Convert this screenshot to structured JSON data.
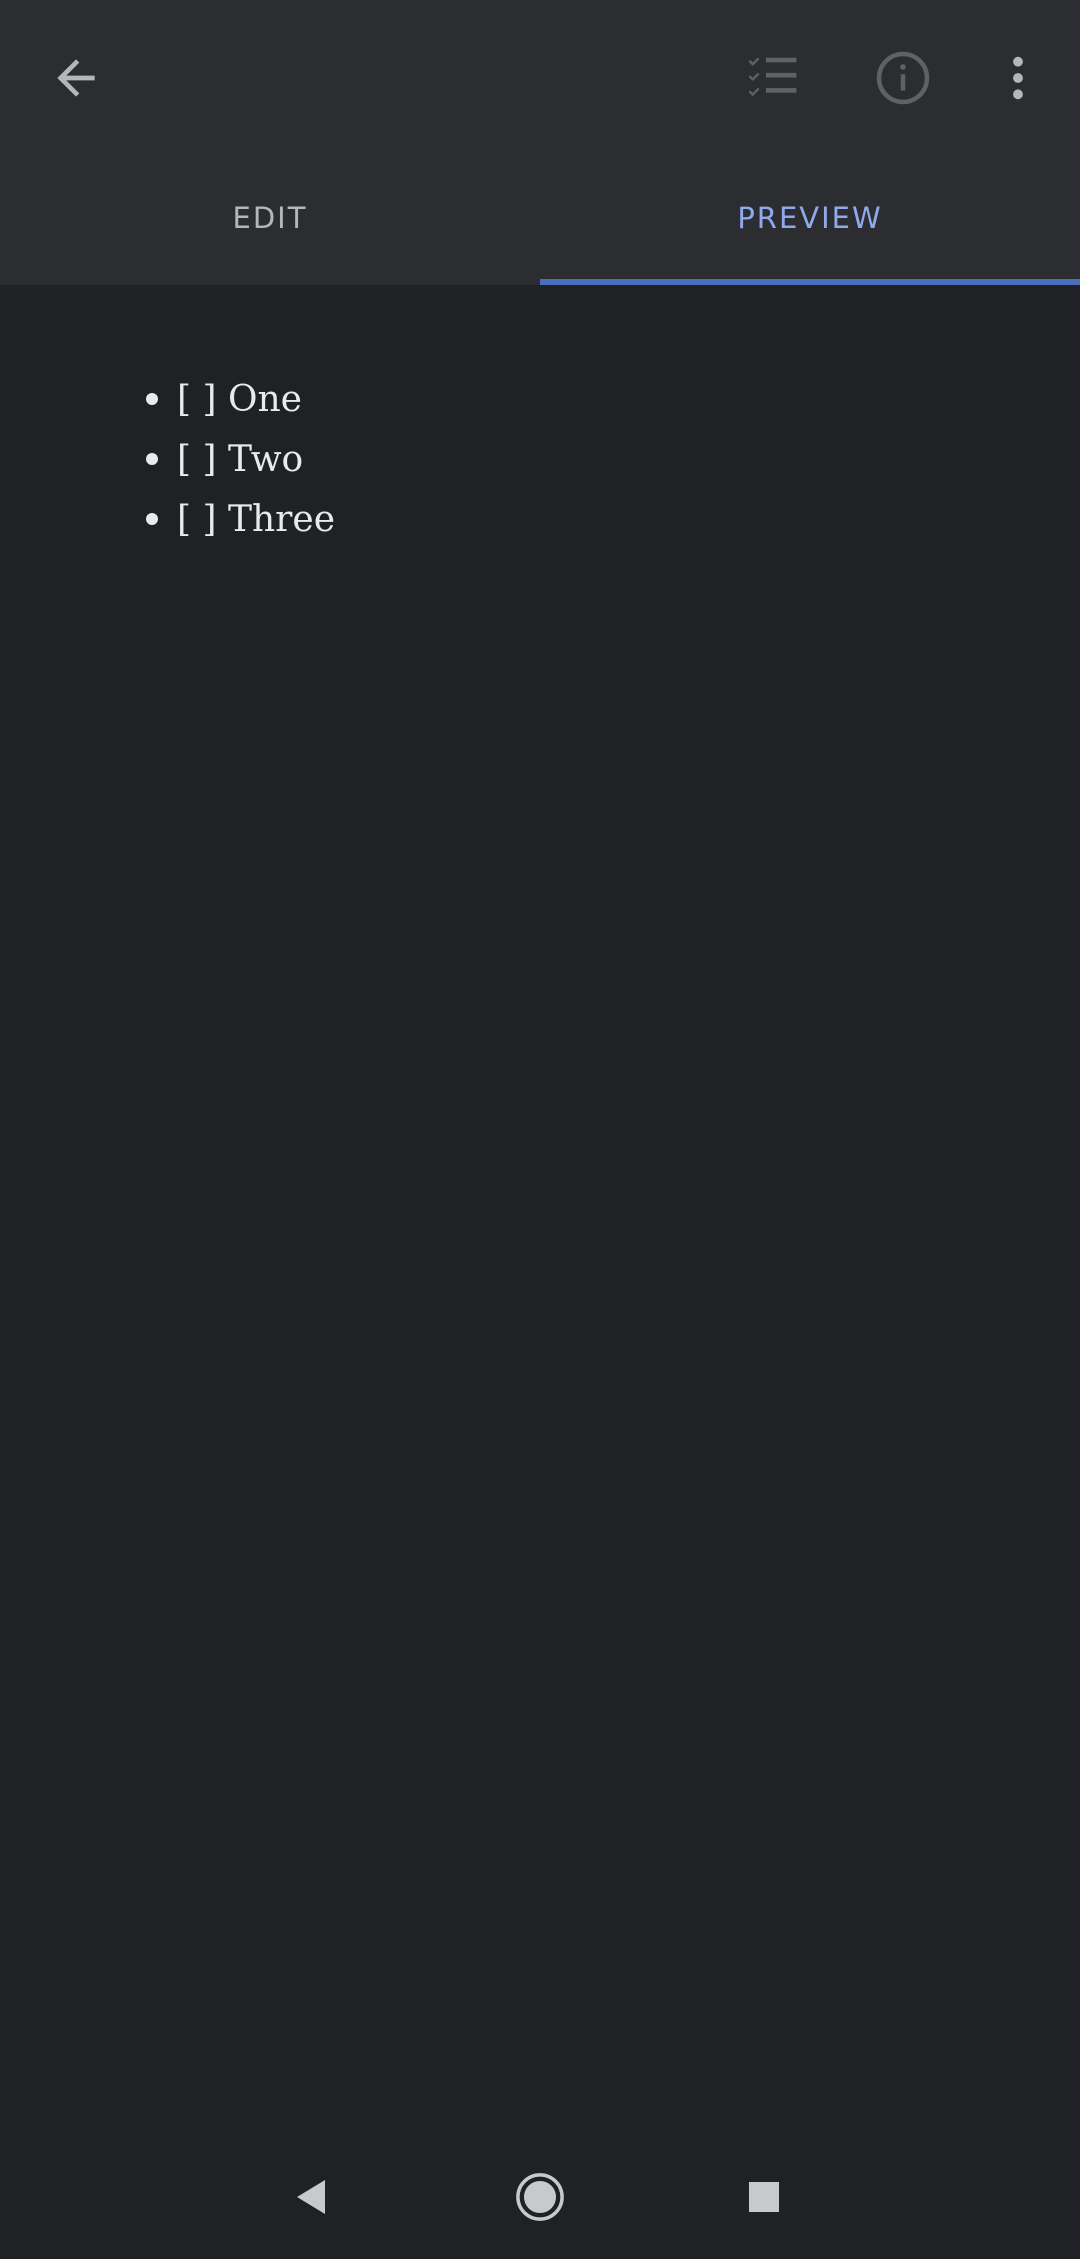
{
  "tabs": [
    {
      "label": "EDIT",
      "selected": false
    },
    {
      "label": "PREVIEW",
      "selected": true
    }
  ],
  "toolbar": {
    "icons": [
      "arrow-back-icon",
      "checklist-icon",
      "info-icon",
      "more-vert-icon"
    ]
  },
  "preview": {
    "items": [
      {
        "text": "[ ] One"
      },
      {
        "text": "[ ] Two"
      },
      {
        "text": "[ ] Three"
      }
    ]
  },
  "system_nav": {
    "icons": [
      "nav-back-icon",
      "nav-home-icon",
      "nav-recents-icon"
    ]
  },
  "colors": {
    "background": "#202124",
    "appbar": "#2c2d30",
    "accent": "#8fa9ea",
    "indicator": "#4a6eb8",
    "text": "#e8eaed"
  }
}
